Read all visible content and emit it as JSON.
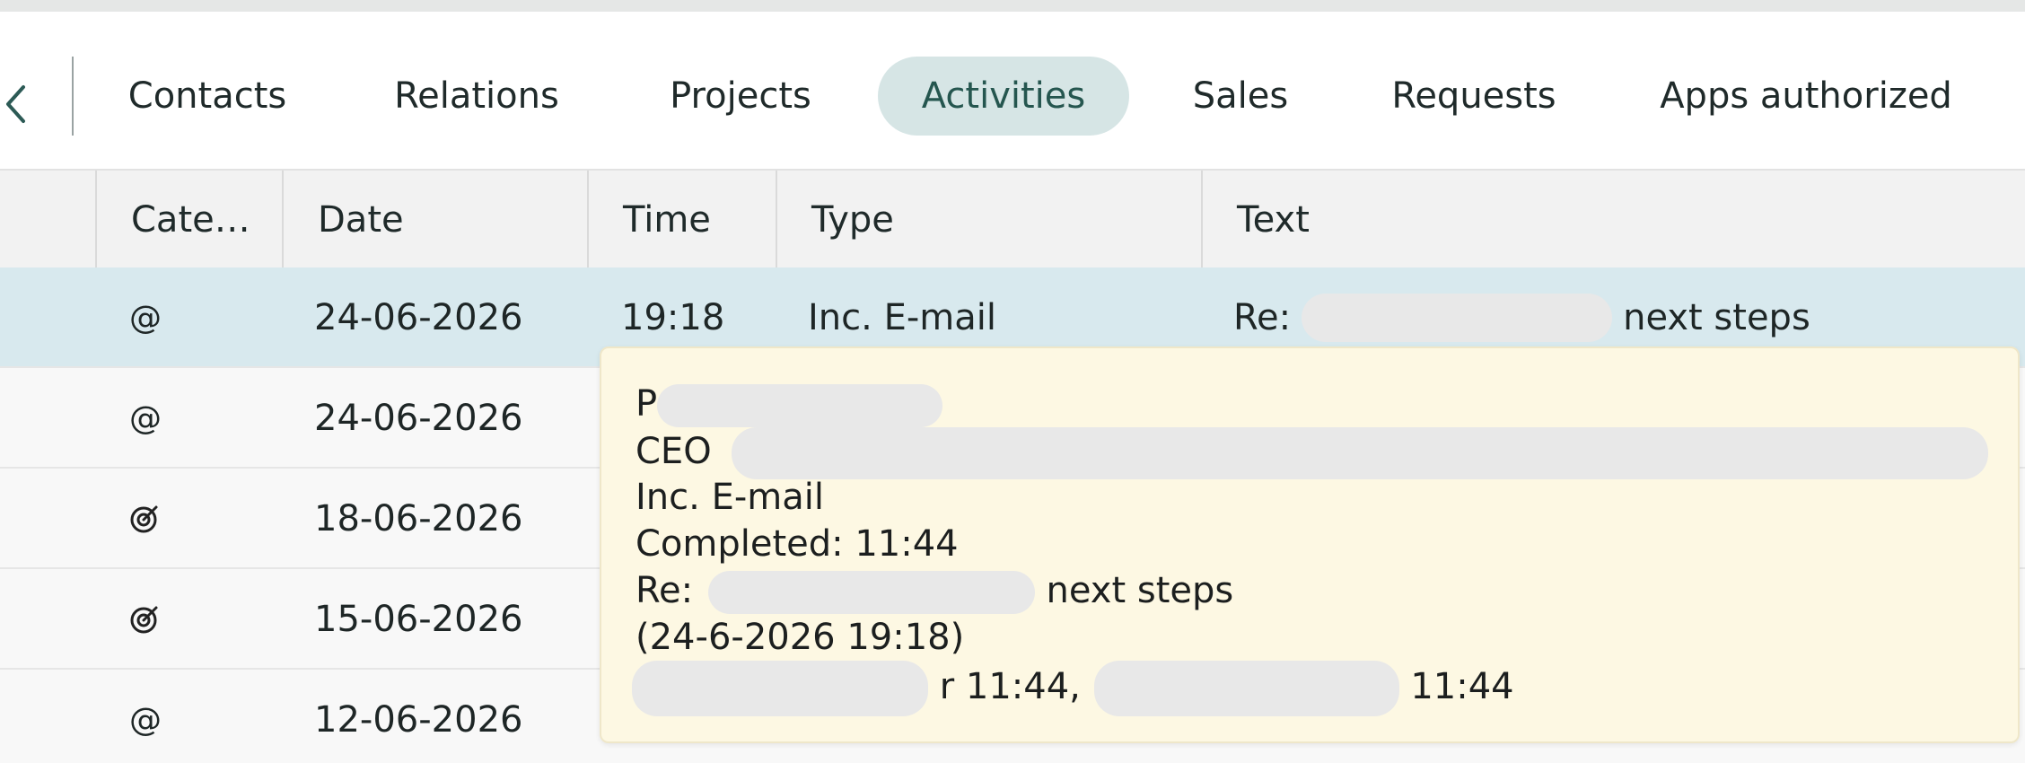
{
  "nav": {
    "back_icon": "chevron-left-icon",
    "tabs": [
      {
        "label": "Contacts",
        "active": false
      },
      {
        "label": "Relations",
        "active": false
      },
      {
        "label": "Projects",
        "active": false
      },
      {
        "label": "Activities",
        "active": true
      },
      {
        "label": "Sales",
        "active": false
      },
      {
        "label": "Requests",
        "active": false
      },
      {
        "label": "Apps authorized",
        "active": false
      }
    ]
  },
  "table": {
    "columns": [
      "Cate…",
      "Date",
      "Time",
      "Type",
      "Text"
    ],
    "rows": [
      {
        "category": "@",
        "category_icon": "at-icon",
        "date": "24-06-2026",
        "time": "19:18",
        "type": "Inc. E-mail",
        "text_prefix": "Re:",
        "text_suffix": "next steps",
        "selected": true
      },
      {
        "category": "@",
        "category_icon": "at-icon",
        "date": "24-06-2026",
        "selected": false
      },
      {
        "category_icon": "target-icon",
        "date": "18-06-2026",
        "selected": false
      },
      {
        "category_icon": "target-icon",
        "date": "15-06-2026",
        "selected": false
      },
      {
        "category": "@",
        "category_icon": "at-icon",
        "date": "12-06-2026",
        "selected": false
      }
    ]
  },
  "tooltip": {
    "name_prefix": "P",
    "role_prefix": "CEO",
    "type": "Inc. E-mail",
    "completed": "Completed: 11:44",
    "subject_prefix": "Re:",
    "subject_suffix": "next steps",
    "datetime": "(24-6-2026 19:18)",
    "log_part1": "r 11:44,",
    "log_part2": "11:44"
  },
  "colors": {
    "active_tab_bg": "#d6e5e5",
    "active_tab_text": "#25564f",
    "selected_row_bg": "#d8e9ee",
    "tooltip_bg": "#fdf8e3"
  }
}
